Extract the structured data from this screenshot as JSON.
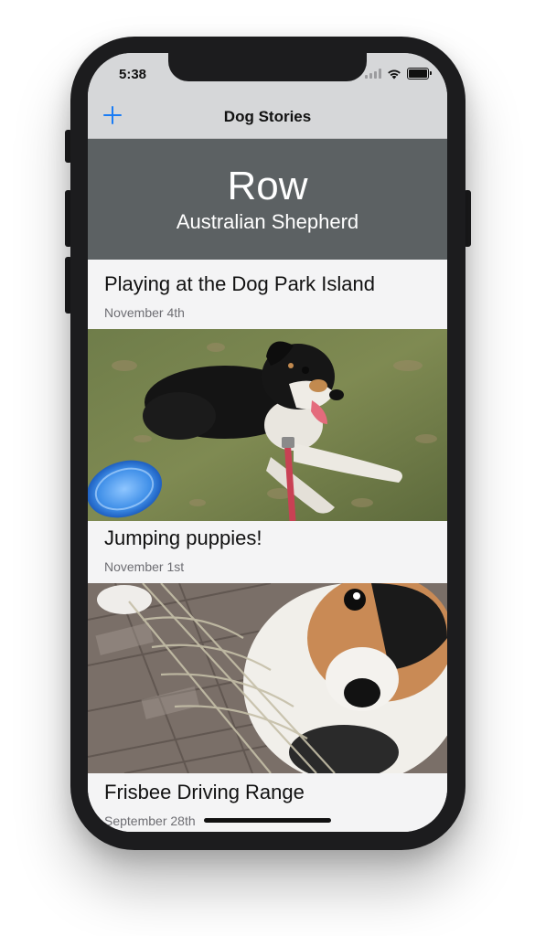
{
  "status_bar": {
    "time": "5:38"
  },
  "nav": {
    "title": "Dog Stories",
    "add_icon": "plus-icon"
  },
  "dog": {
    "name": "Row",
    "breed": "Australian Shepherd"
  },
  "stories": [
    {
      "title": "Playing at the Dog Park Island",
      "date": "November 4th"
    },
    {
      "title": "Jumping puppies!",
      "date": "November 1st"
    },
    {
      "title": "Frisbee Driving Range",
      "date": "September 28th"
    }
  ],
  "colors": {
    "accent": "#1a7cf5",
    "header_bg": "#5c6163",
    "nav_bg": "#d6d7d9"
  }
}
